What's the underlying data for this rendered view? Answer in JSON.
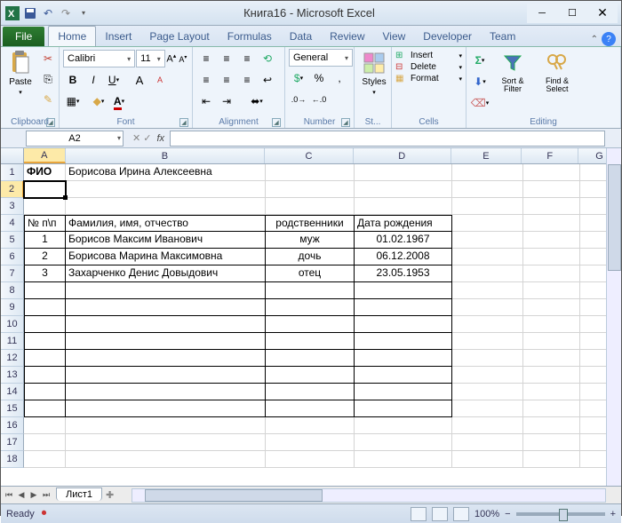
{
  "window": {
    "title": "Книга16 - Microsoft Excel"
  },
  "tabs": {
    "file": "File",
    "home": "Home",
    "insert": "Insert",
    "page": "Page Layout",
    "formulas": "Formulas",
    "data": "Data",
    "review": "Review",
    "view": "View",
    "developer": "Developer",
    "team": "Team"
  },
  "ribbon": {
    "clipboard": {
      "label": "Clipboard",
      "paste": "Paste"
    },
    "font": {
      "label": "Font",
      "name": "Calibri",
      "size": "11"
    },
    "alignment": {
      "label": "Alignment"
    },
    "number": {
      "label": "Number",
      "format": "General"
    },
    "styles": {
      "label": "St...",
      "btn": "Styles"
    },
    "cells": {
      "label": "Cells",
      "insert": "Insert",
      "delete": "Delete",
      "format": "Format"
    },
    "editing": {
      "label": "Editing",
      "sort": "Sort & Filter",
      "find": "Find & Select"
    }
  },
  "namebox": "A2",
  "columns": [
    "A",
    "B",
    "C",
    "D",
    "E",
    "F",
    "G"
  ],
  "rows": [
    "1",
    "2",
    "3",
    "4",
    "5",
    "6",
    "7",
    "8",
    "9",
    "10",
    "11",
    "12",
    "13",
    "14",
    "15",
    "16",
    "17",
    "18"
  ],
  "cells": {
    "a1": "ФИО",
    "b1": "Борисова Ирина Алексеевна",
    "a4": "№ п\\п",
    "b4": "Фамилия, имя, отчество",
    "c4": "родственники",
    "d4": "Дата рождения",
    "a5": "1",
    "b5": "Борисов Максим Иванович",
    "c5": "муж",
    "d5": "01.02.1967",
    "a6": "2",
    "b6": "Борисова Марина Максимовна",
    "c6": "дочь",
    "d6": "06.12.2008",
    "a7": "3",
    "b7": "Захарченко Денис Довыдович",
    "c7": "отец",
    "d7": "23.05.1953"
  },
  "sheet": {
    "tab1": "Лист1"
  },
  "status": {
    "ready": "Ready",
    "zoom": "100%"
  }
}
